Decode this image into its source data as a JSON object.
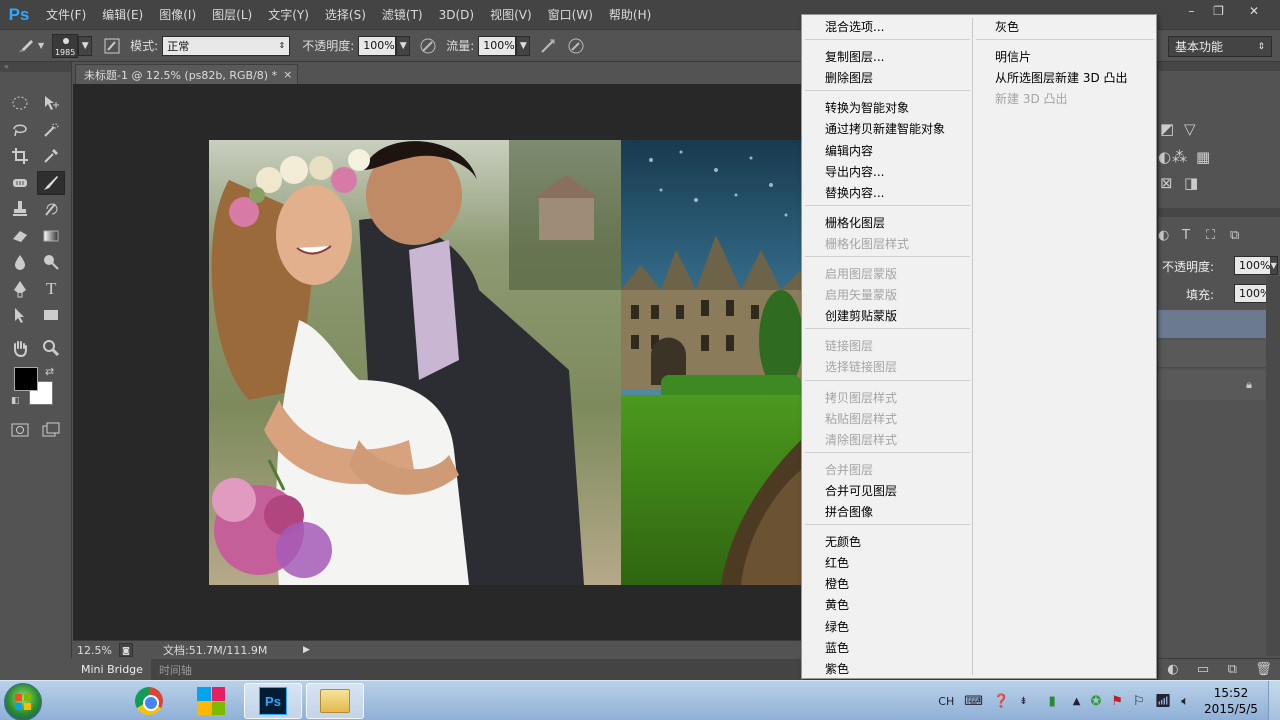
{
  "menubar": {
    "logo": "Ps",
    "items": [
      "文件(F)",
      "编辑(E)",
      "图像(I)",
      "图层(L)",
      "文字(Y)",
      "选择(S)",
      "滤镜(T)",
      "3D(D)",
      "视图(V)",
      "窗口(W)",
      "帮助(H)"
    ],
    "window_controls": [
      "–",
      "❐",
      "✕"
    ]
  },
  "options_bar": {
    "brush_size": "1985",
    "mode_label": "模式:",
    "mode_value": "正常",
    "opacity_label": "不透明度:",
    "opacity_value": "100%",
    "flow_label": "流量:",
    "flow_value": "100%",
    "workspace": "基本功能"
  },
  "document": {
    "tab_title": "未标题-1 @ 12.5% (ps82b, RGB/8) *",
    "tab_close": "×",
    "zoom": "12.5%",
    "doc_info": "文档:51.7M/111.9M"
  },
  "bottom_tabs": [
    "Mini Bridge",
    "时间轴"
  ],
  "context_menu": {
    "column1": [
      {
        "label": "混合选项...",
        "enabled": true
      },
      {
        "sep": true
      },
      {
        "label": "复制图层...",
        "enabled": true
      },
      {
        "label": "删除图层",
        "enabled": true
      },
      {
        "sep": true
      },
      {
        "label": "转换为智能对象",
        "enabled": true
      },
      {
        "label": "通过拷贝新建智能对象",
        "enabled": true
      },
      {
        "label": "编辑内容",
        "enabled": true
      },
      {
        "label": "导出内容...",
        "enabled": true
      },
      {
        "label": "替换内容...",
        "enabled": true
      },
      {
        "sep": true
      },
      {
        "label": "栅格化图层",
        "enabled": true
      },
      {
        "label": "栅格化图层样式",
        "enabled": false
      },
      {
        "sep": true
      },
      {
        "label": "启用图层蒙版",
        "enabled": false
      },
      {
        "label": "启用矢量蒙版",
        "enabled": false
      },
      {
        "label": "创建剪贴蒙版",
        "enabled": true
      },
      {
        "sep": true
      },
      {
        "label": "链接图层",
        "enabled": false
      },
      {
        "label": "选择链接图层",
        "enabled": false
      },
      {
        "sep": true
      },
      {
        "label": "拷贝图层样式",
        "enabled": false
      },
      {
        "label": "粘贴图层样式",
        "enabled": false
      },
      {
        "label": "清除图层样式",
        "enabled": false
      },
      {
        "sep": true
      },
      {
        "label": "合并图层",
        "enabled": false
      },
      {
        "label": "合并可见图层",
        "enabled": true
      },
      {
        "label": "拼合图像",
        "enabled": true
      },
      {
        "sep": true
      },
      {
        "label": "无颜色",
        "enabled": true
      },
      {
        "label": "红色",
        "enabled": true
      },
      {
        "label": "橙色",
        "enabled": true
      },
      {
        "label": "黄色",
        "enabled": true
      },
      {
        "label": "绿色",
        "enabled": true
      },
      {
        "label": "蓝色",
        "enabled": true
      },
      {
        "label": "紫色",
        "enabled": true
      }
    ],
    "column2": [
      {
        "label": "灰色",
        "enabled": true
      },
      {
        "sep": true
      },
      {
        "label": "明信片",
        "enabled": true
      },
      {
        "label": "从所选图层新建 3D 凸出",
        "enabled": true
      },
      {
        "label": "新建 3D 凸出",
        "enabled": false
      }
    ]
  },
  "layers_panel": {
    "opacity_label": "不透明度:",
    "opacity_value": "100%",
    "fill_label": "填充:",
    "fill_value": "100%"
  },
  "taskbar": {
    "ime": "CH",
    "time": "15:52",
    "date": "2015/5/5",
    "ps_label": "Ps"
  }
}
